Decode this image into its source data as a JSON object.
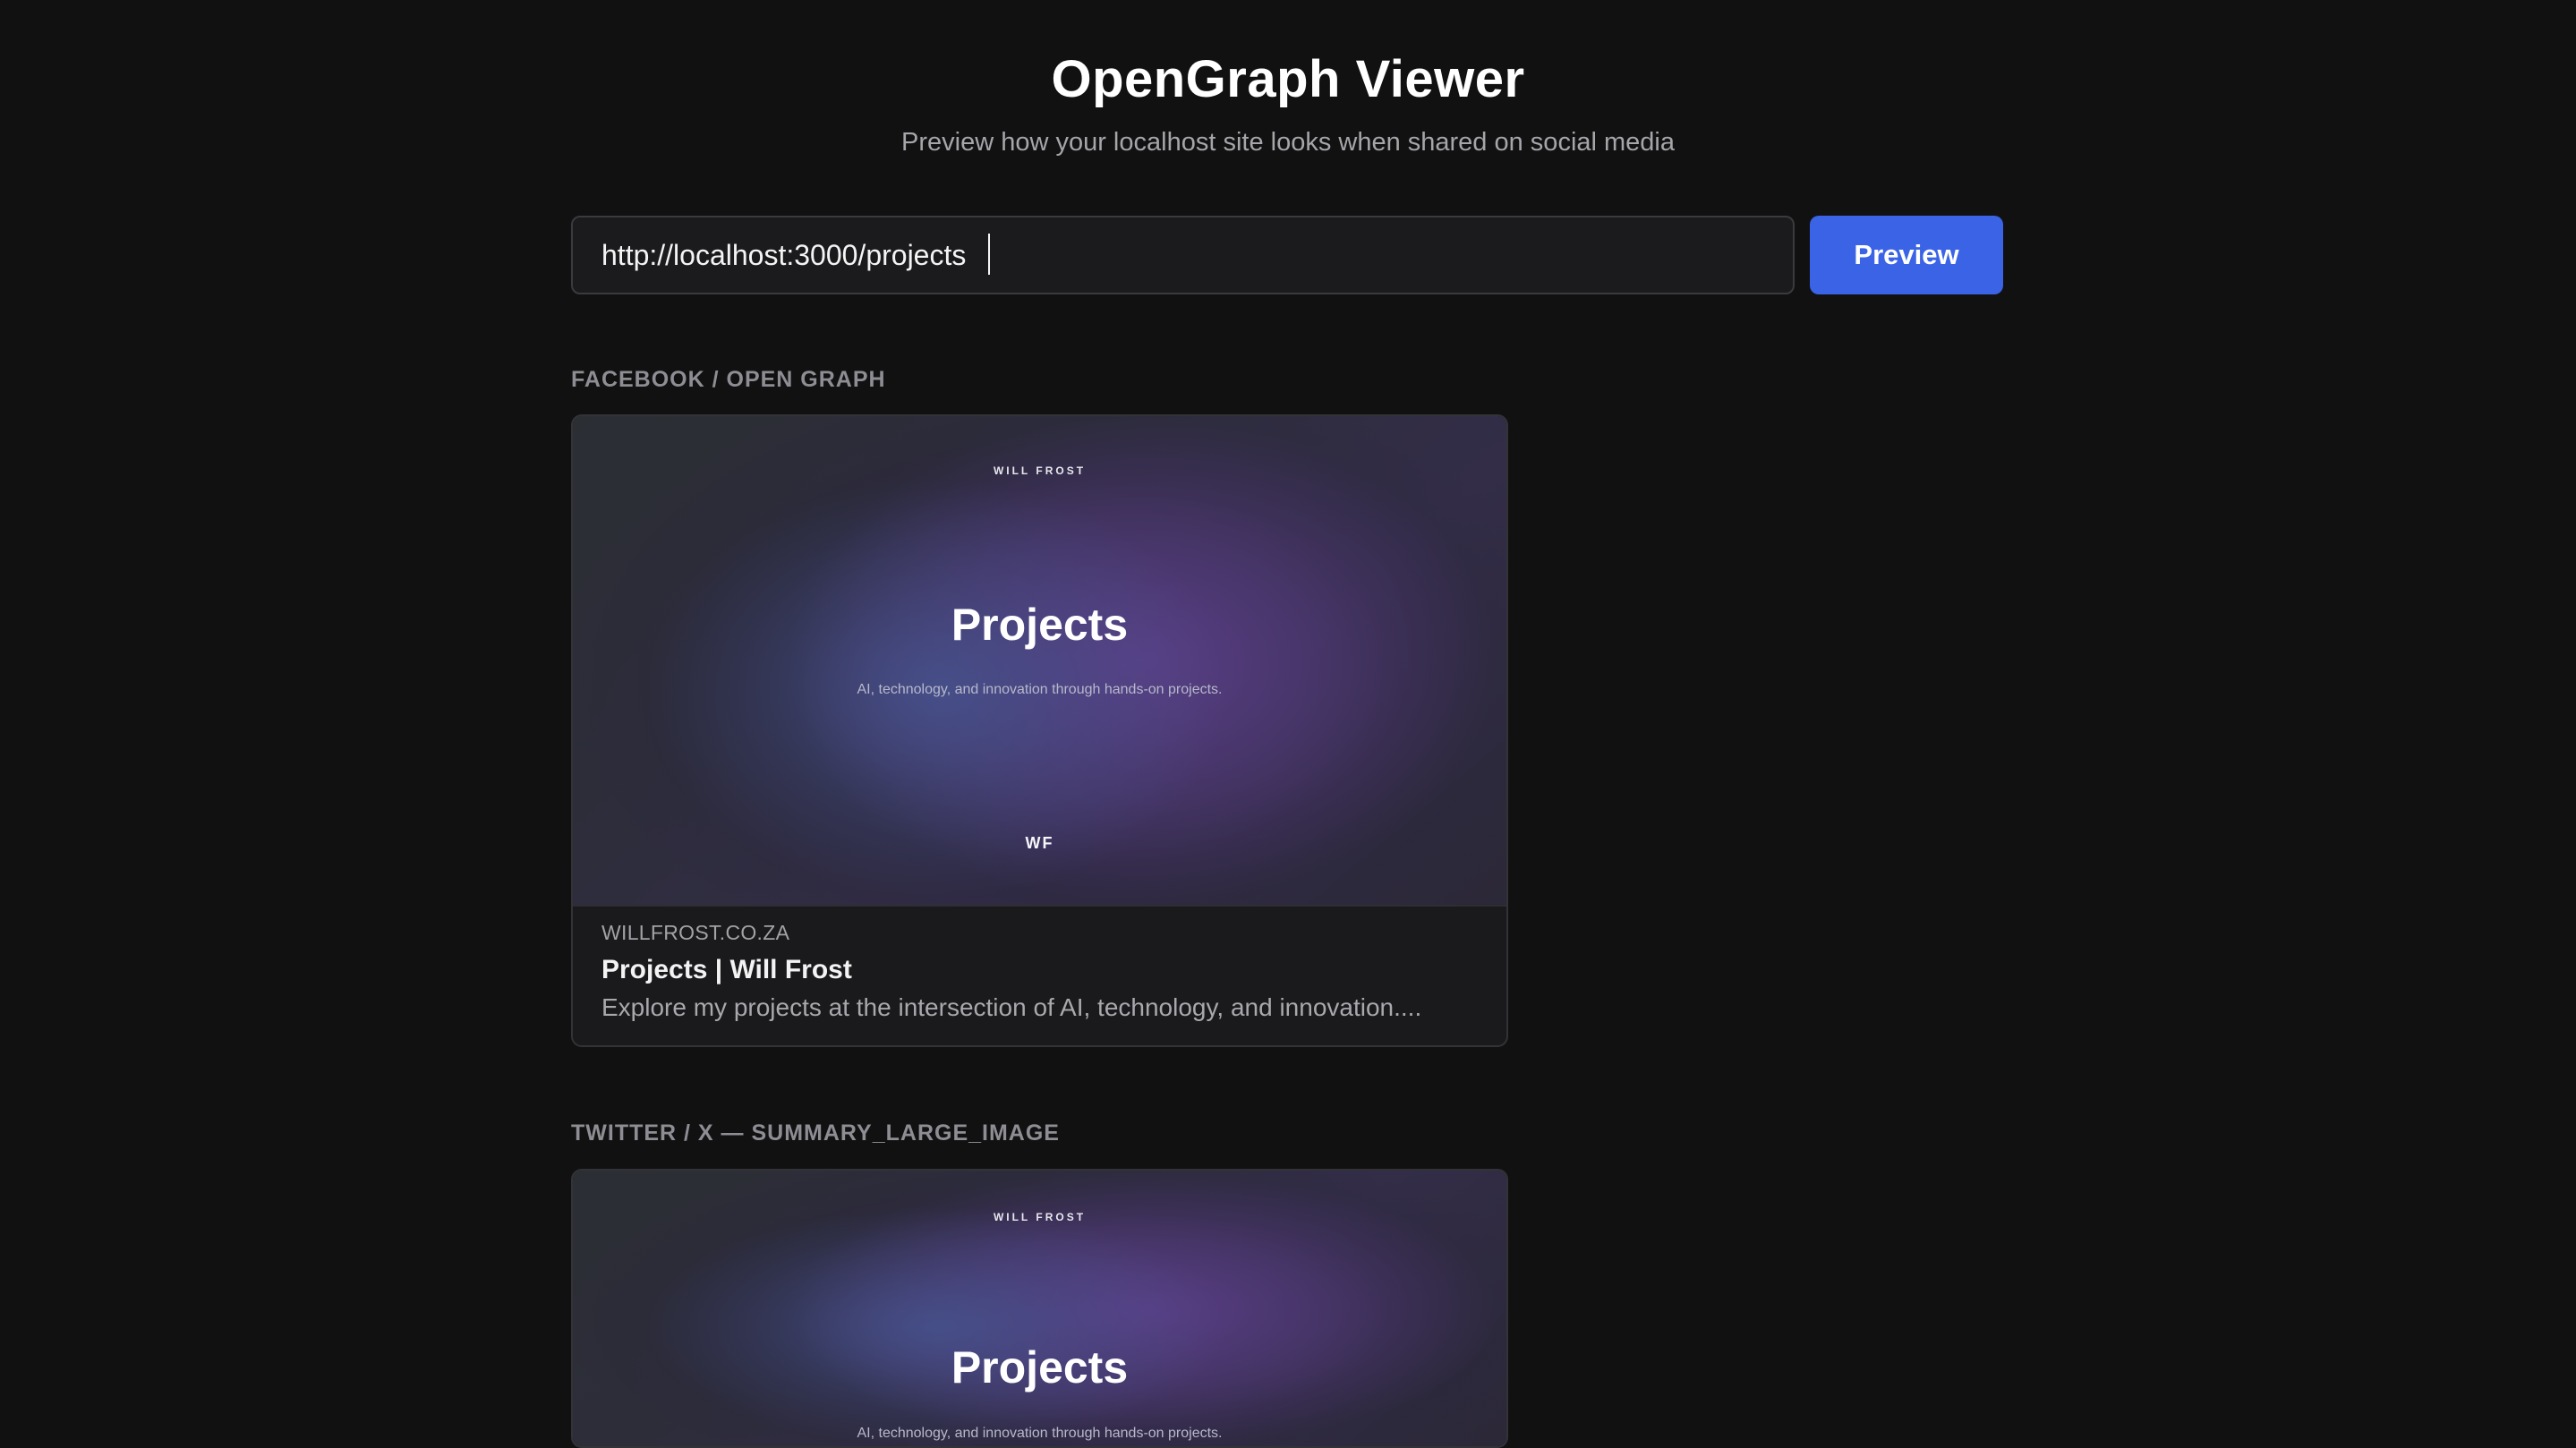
{
  "header": {
    "title": "OpenGraph Viewer",
    "subtitle": "Preview how your localhost site looks when shared on social media"
  },
  "url_form": {
    "value": "http://localhost:3000/projects",
    "button_label": "Preview"
  },
  "sections": {
    "facebook": {
      "label": "FACEBOOK / OPEN GRAPH",
      "image": {
        "top_label": "WILL FROST",
        "title": "Projects",
        "subtitle": "AI, technology, and innovation through hands-on projects.",
        "mark": "WF"
      },
      "domain": "WILLFROST.CO.ZA",
      "title": "Projects | Will Frost",
      "description": "Explore my projects at the intersection of AI, technology, and innovation...."
    },
    "twitter": {
      "label": "TWITTER / X — SUMMARY_LARGE_IMAGE",
      "image": {
        "top_label": "WILL FROST",
        "title": "Projects",
        "subtitle": "AI, technology, and innovation through hands-on projects."
      }
    }
  },
  "colors": {
    "background": "#111112",
    "input_background": "#1b1b1d",
    "accent": "#3b63e6",
    "muted_text": "#a5a5aa"
  },
  "icons": []
}
